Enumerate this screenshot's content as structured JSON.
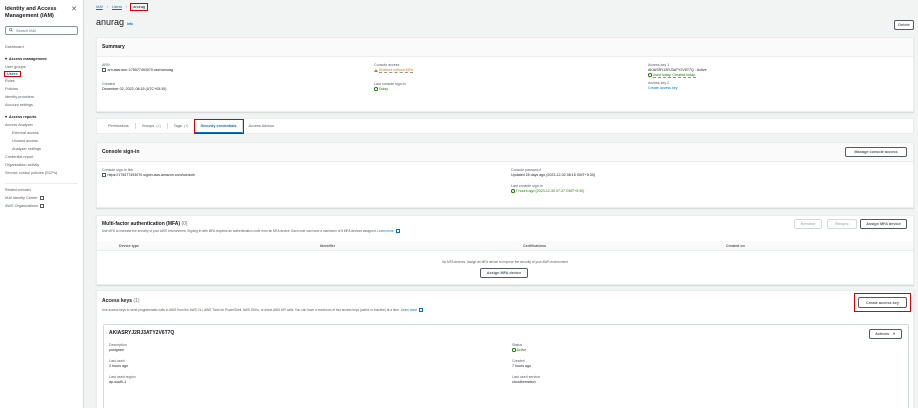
{
  "sidebar": {
    "title": "Identity and Access Management (IAM)",
    "search_placeholder": "Search IAM",
    "dashboard": "Dashboard",
    "access_management": {
      "heading": "Access management",
      "items": [
        "User groups",
        "Users",
        "Roles",
        "Policies",
        "Identity providers",
        "Account settings"
      ]
    },
    "access_reports": {
      "heading": "Access reports",
      "access_analyzer": "Access Analyzer",
      "sub_items": [
        "External access",
        "Unused access",
        "Analyzer settings"
      ],
      "items": [
        "Credential report",
        "Organization activity",
        "Service control policies (SCPs)"
      ]
    },
    "related": {
      "heading": "Related consoles",
      "items": [
        "IAM Identity Center",
        "AWS Organizations"
      ]
    }
  },
  "breadcrumb": {
    "root": "IAM",
    "section": "Users",
    "current": "anurag"
  },
  "page": {
    "title": "anurag",
    "info": "Info",
    "delete_label": "Delete"
  },
  "summary": {
    "heading": "Summary",
    "arn_label": "ARN",
    "arn_value": "arn:aws:iam::175577493070:user/anurag",
    "created_label": "Created",
    "created_value": "December 02, 2023, 08:15 (UTC+05:30)",
    "console_access_label": "Console access",
    "console_access_value": "Enabled without MFA",
    "last_signin_label": "Last console sign-in",
    "last_signin_value": "Today",
    "key1_label": "Access key 1",
    "key1_value": "AKIASRYJ2RJ3ATY2V6T7Q - Active",
    "key1_status": "Used today. Created today.",
    "key2_label": "Access key 2",
    "key2_link": "Create access key"
  },
  "tabs": [
    {
      "label": "Permissions",
      "count": ""
    },
    {
      "label": "Groups",
      "count": "(1)"
    },
    {
      "label": "Tags",
      "count": "(1)"
    },
    {
      "label": "Security credentials",
      "count": ""
    },
    {
      "label": "Access Advisor",
      "count": ""
    }
  ],
  "console_signin": {
    "heading": "Console sign-in",
    "manage_label": "Manage console access",
    "link_label": "Console sign-in link",
    "link_value": "https://175577493070.signin.aws.amazon.com/console",
    "password_label": "Console password",
    "password_value": "Updated 28 days ago (2023-12-02 08:15 GMT+5:30)",
    "last_signin_label": "Last console sign-in",
    "last_signin_value": "7 hours ago (2023-12-30 07:37 GMT+5:30)"
  },
  "mfa": {
    "heading": "Multi-factor authentication (MFA)",
    "count": "(0)",
    "desc": "Use MFA to increase the security of your AWS environment. Signing in with MFA requires an authentication code from an MFA device. Each user can have a maximum of 8 MFA devices assigned.",
    "learn_more": "Learn more",
    "remove_label": "Remove",
    "resync_label": "Resync",
    "assign_label": "Assign MFA device",
    "columns": [
      "Device type",
      "Identifier",
      "Certifications",
      "Created on"
    ],
    "empty_title": "No MFA devices. Assign an MFA device to improve the security of your AWS environment",
    "empty_button": "Assign MFA device"
  },
  "access_keys": {
    "heading": "Access keys",
    "count": "(1)",
    "desc": "Use access keys to send programmatic calls to AWS from the AWS CLI, AWS Tools for PowerShell, AWS SDKs, or direct AWS API calls. You can have a maximum of two access keys (active or inactive) at a time.",
    "learn_more": "Learn more",
    "create_label": "Create access key",
    "key": {
      "id": "AKIASRYJ2RJ3ATY2V6T7Q",
      "actions_label": "Actions",
      "description_label": "Description",
      "description_value": "postgram",
      "status_label": "Status",
      "status_value": "Active",
      "last_used_label": "Last used",
      "last_used_value": "3 hours ago",
      "created_label": "Created",
      "created_value": "7 hours ago",
      "region_label": "Last used region",
      "region_value": "ap-south-1",
      "service_label": "Last used service",
      "service_value": "cloudformation"
    }
  },
  "colors": {
    "accent": "#0073bb",
    "highlight": "#dd0000",
    "success": "#1d8102",
    "warning": "#d87b00"
  }
}
